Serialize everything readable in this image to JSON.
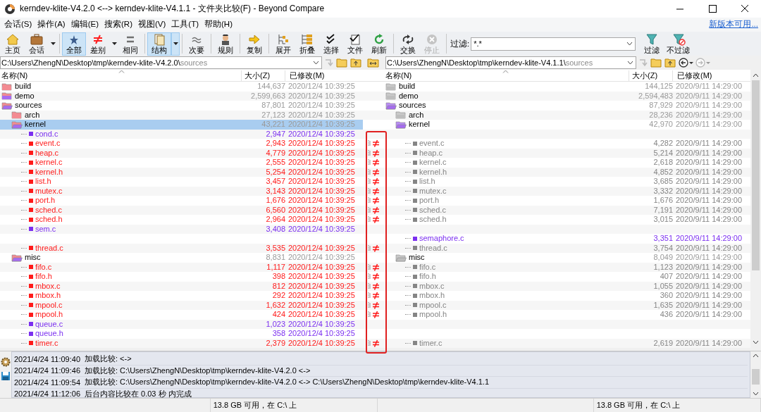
{
  "window": {
    "title": "kerndev-klite-V4.2.0 <--> kerndev-klite-V4.1.1 - 文件夹比较(F) - Beyond Compare"
  },
  "menu": [
    "会话(S)",
    "操作(A)",
    "编辑(E)",
    "搜索(R)",
    "视图(V)",
    "工具(T)",
    "帮助(H)"
  ],
  "update_link": "新版本可用...",
  "toolbar": {
    "groups": [
      [
        {
          "label": "主页",
          "selected": false,
          "disabled": false,
          "dropdown": false
        },
        {
          "label": "会话",
          "selected": false,
          "disabled": false,
          "dropdown": true
        }
      ],
      [
        {
          "label": "全部",
          "selected": true,
          "disabled": false,
          "dropdown": false
        },
        {
          "label": "差别",
          "selected": false,
          "disabled": false,
          "dropdown": true
        },
        {
          "label": "相同",
          "selected": false,
          "disabled": false,
          "dropdown": false
        }
      ],
      [
        {
          "label": "结构",
          "selected": true,
          "disabled": false,
          "dropdown": true
        }
      ],
      [
        {
          "label": "次要",
          "selected": false,
          "disabled": false,
          "dropdown": false
        }
      ],
      [
        {
          "label": "规则",
          "selected": false,
          "disabled": false,
          "dropdown": false
        }
      ],
      [
        {
          "label": "复制",
          "selected": false,
          "disabled": false,
          "dropdown": false
        }
      ],
      [
        {
          "label": "展开",
          "selected": false,
          "disabled": false,
          "dropdown": false
        },
        {
          "label": "折叠",
          "selected": false,
          "disabled": false,
          "dropdown": false
        },
        {
          "label": "选择",
          "selected": false,
          "disabled": false,
          "dropdown": false
        },
        {
          "label": "文件",
          "selected": false,
          "disabled": false,
          "dropdown": false
        },
        {
          "label": "刷新",
          "selected": false,
          "disabled": false,
          "dropdown": false
        }
      ],
      [
        {
          "label": "交换",
          "selected": false,
          "disabled": false,
          "dropdown": false
        },
        {
          "label": "停止",
          "selected": false,
          "disabled": true,
          "dropdown": false
        }
      ]
    ],
    "filter": {
      "label": "过滤:",
      "value": "*.*"
    },
    "filter_buttons": [
      "过滤",
      "不过滤"
    ]
  },
  "left_path": {
    "base": "C:\\Users\\ZhengN\\Desktop\\tmp\\kerndev-klite-V4.2.0\\",
    "subfolder": "sources"
  },
  "right_path": {
    "base": "C:\\Users\\ZhengN\\Desktop\\tmp\\kerndev-klite-V4.1.1\\",
    "subfolder": "sources"
  },
  "left_columns": [
    "名称(N)",
    "大小(Z)",
    "已修改(M)"
  ],
  "right_columns": [
    "名称(N)",
    "大小(Z)",
    "已修改(M)"
  ],
  "rows": [
    {
      "kind": "folder",
      "expanded": false,
      "selected": false,
      "diff": false,
      "left": {
        "name": "build",
        "size": "144,637",
        "modified": "2020/12/4 10:39:25",
        "differs": true,
        "has_orphans": false
      },
      "right": {
        "name": "build",
        "size": "144,125",
        "modified": "2020/9/11 14:29:00",
        "differs": false,
        "has_orphans": false
      }
    },
    {
      "kind": "folder",
      "expanded": false,
      "selected": false,
      "diff": false,
      "left": {
        "name": "demo",
        "size": "2,599,663",
        "modified": "2020/12/4 10:39:25",
        "differs": true,
        "has_orphans": true
      },
      "right": {
        "name": "demo",
        "size": "2,594,483",
        "modified": "2020/9/11 14:29:00",
        "differs": false,
        "has_orphans": false
      }
    },
    {
      "kind": "folder",
      "expanded": true,
      "selected": false,
      "diff": false,
      "left": {
        "name": "sources",
        "size": "87,801",
        "modified": "2020/12/4 10:39:25",
        "differs": true,
        "has_orphans": true
      },
      "right": {
        "name": "sources",
        "size": "87,929",
        "modified": "2020/9/11 14:29:00",
        "differs": false,
        "has_orphans": true
      },
      "children": [
        {
          "kind": "folder",
          "expanded": false,
          "selected": false,
          "diff": false,
          "left": {
            "name": "arch",
            "size": "27,123",
            "modified": "2020/12/4 10:39:25",
            "differs": true,
            "has_orphans": false
          },
          "right": {
            "name": "arch",
            "size": "28,236",
            "modified": "2020/9/11 14:29:00",
            "differs": false,
            "has_orphans": false
          }
        },
        {
          "kind": "folder",
          "expanded": true,
          "selected": true,
          "diff": false,
          "left": {
            "name": "kernel",
            "size": "43,221",
            "modified": "2020/12/4 10:39:25",
            "differs": true,
            "has_orphans": true
          },
          "right": {
            "name": "kernel",
            "size": "42,970",
            "modified": "2020/9/11 14:29:00",
            "differs": false,
            "has_orphans": true
          },
          "children": [
            {
              "kind": "file",
              "selected": false,
              "diff": false,
              "left": {
                "name": "cond.c",
                "size": "2,947",
                "modified": "2020/12/4 10:39:25",
                "newer": false,
                "orphan": true
              }
            },
            {
              "kind": "file",
              "selected": false,
              "diff": true,
              "left": {
                "name": "event.c",
                "size": "2,943",
                "modified": "2020/12/4 10:39:25",
                "newer": true,
                "orphan": false
              },
              "right": {
                "name": "event.c",
                "size": "4,282",
                "modified": "2020/9/11 14:29:00",
                "newer": false,
                "orphan": false
              }
            },
            {
              "kind": "file",
              "selected": false,
              "diff": true,
              "left": {
                "name": "heap.c",
                "size": "4,779",
                "modified": "2020/12/4 10:39:25",
                "newer": true,
                "orphan": false
              },
              "right": {
                "name": "heap.c",
                "size": "5,214",
                "modified": "2020/9/11 14:29:00",
                "newer": false,
                "orphan": false
              }
            },
            {
              "kind": "file",
              "selected": false,
              "diff": true,
              "left": {
                "name": "kernel.c",
                "size": "2,555",
                "modified": "2020/12/4 10:39:25",
                "newer": true,
                "orphan": false
              },
              "right": {
                "name": "kernel.c",
                "size": "2,618",
                "modified": "2020/9/11 14:29:00",
                "newer": false,
                "orphan": false
              }
            },
            {
              "kind": "file",
              "selected": false,
              "diff": true,
              "left": {
                "name": "kernel.h",
                "size": "5,254",
                "modified": "2020/12/4 10:39:25",
                "newer": true,
                "orphan": false
              },
              "right": {
                "name": "kernel.h",
                "size": "4,852",
                "modified": "2020/9/11 14:29:00",
                "newer": false,
                "orphan": false
              }
            },
            {
              "kind": "file",
              "selected": false,
              "diff": true,
              "left": {
                "name": "list.h",
                "size": "3,457",
                "modified": "2020/12/4 10:39:25",
                "newer": true,
                "orphan": false
              },
              "right": {
                "name": "list.h",
                "size": "3,685",
                "modified": "2020/9/11 14:29:00",
                "newer": false,
                "orphan": false
              }
            },
            {
              "kind": "file",
              "selected": false,
              "diff": true,
              "left": {
                "name": "mutex.c",
                "size": "3,143",
                "modified": "2020/12/4 10:39:25",
                "newer": true,
                "orphan": false
              },
              "right": {
                "name": "mutex.c",
                "size": "3,332",
                "modified": "2020/9/11 14:29:00",
                "newer": false,
                "orphan": false
              }
            },
            {
              "kind": "file",
              "selected": false,
              "diff": true,
              "left": {
                "name": "port.h",
                "size": "1,676",
                "modified": "2020/12/4 10:39:25",
                "newer": true,
                "orphan": false
              },
              "right": {
                "name": "port.h",
                "size": "1,676",
                "modified": "2020/9/11 14:29:00",
                "newer": false,
                "orphan": false
              }
            },
            {
              "kind": "file",
              "selected": false,
              "diff": true,
              "left": {
                "name": "sched.c",
                "size": "6,560",
                "modified": "2020/12/4 10:39:25",
                "newer": true,
                "orphan": false
              },
              "right": {
                "name": "sched.c",
                "size": "7,191",
                "modified": "2020/9/11 14:29:00",
                "newer": false,
                "orphan": false
              }
            },
            {
              "kind": "file",
              "selected": false,
              "diff": true,
              "left": {
                "name": "sched.h",
                "size": "2,964",
                "modified": "2020/12/4 10:39:25",
                "newer": true,
                "orphan": false
              },
              "right": {
                "name": "sched.h",
                "size": "3,015",
                "modified": "2020/9/11 14:29:00",
                "newer": false,
                "orphan": false
              }
            },
            {
              "kind": "file",
              "selected": false,
              "diff": false,
              "left": {
                "name": "sem.c",
                "size": "3,408",
                "modified": "2020/12/4 10:39:25",
                "newer": false,
                "orphan": true
              }
            },
            {
              "kind": "file",
              "selected": false,
              "diff": false,
              "right": {
                "name": "semaphore.c",
                "size": "3,351",
                "modified": "2020/9/11 14:29:00",
                "newer": false,
                "orphan": true
              }
            },
            {
              "kind": "file",
              "selected": false,
              "diff": true,
              "left": {
                "name": "thread.c",
                "size": "3,535",
                "modified": "2020/12/4 10:39:25",
                "newer": true,
                "orphan": false
              },
              "right": {
                "name": "thread.c",
                "size": "3,754",
                "modified": "2020/9/11 14:29:00",
                "newer": false,
                "orphan": false
              }
            }
          ]
        },
        {
          "kind": "folder",
          "expanded": true,
          "selected": false,
          "diff": false,
          "left": {
            "name": "misc",
            "size": "8,831",
            "modified": "2020/12/4 10:39:25",
            "differs": true,
            "has_orphans": true
          },
          "right": {
            "name": "misc",
            "size": "8,049",
            "modified": "2020/9/11 14:29:00",
            "differs": false,
            "has_orphans": false
          },
          "children": [
            {
              "kind": "file",
              "selected": false,
              "diff": true,
              "left": {
                "name": "fifo.c",
                "size": "1,117",
                "modified": "2020/12/4 10:39:25",
                "newer": true,
                "orphan": false
              },
              "right": {
                "name": "fifo.c",
                "size": "1,123",
                "modified": "2020/9/11 14:29:00",
                "newer": false,
                "orphan": false
              }
            },
            {
              "kind": "file",
              "selected": false,
              "diff": true,
              "left": {
                "name": "fifo.h",
                "size": "398",
                "modified": "2020/12/4 10:39:25",
                "newer": true,
                "orphan": false
              },
              "right": {
                "name": "fifo.h",
                "size": "407",
                "modified": "2020/9/11 14:29:00",
                "newer": false,
                "orphan": false
              }
            },
            {
              "kind": "file",
              "selected": false,
              "diff": true,
              "left": {
                "name": "mbox.c",
                "size": "812",
                "modified": "2020/12/4 10:39:25",
                "newer": true,
                "orphan": false
              },
              "right": {
                "name": "mbox.c",
                "size": "1,055",
                "modified": "2020/9/11 14:29:00",
                "newer": false,
                "orphan": false
              }
            },
            {
              "kind": "file",
              "selected": false,
              "diff": true,
              "left": {
                "name": "mbox.h",
                "size": "292",
                "modified": "2020/12/4 10:39:25",
                "newer": true,
                "orphan": false
              },
              "right": {
                "name": "mbox.h",
                "size": "360",
                "modified": "2020/9/11 14:29:00",
                "newer": false,
                "orphan": false
              }
            },
            {
              "kind": "file",
              "selected": false,
              "diff": true,
              "left": {
                "name": "mpool.c",
                "size": "1,632",
                "modified": "2020/12/4 10:39:25",
                "newer": true,
                "orphan": false
              },
              "right": {
                "name": "mpool.c",
                "size": "1,635",
                "modified": "2020/9/11 14:29:00",
                "newer": false,
                "orphan": false
              }
            },
            {
              "kind": "file",
              "selected": false,
              "diff": true,
              "left": {
                "name": "mpool.h",
                "size": "424",
                "modified": "2020/12/4 10:39:25",
                "newer": true,
                "orphan": false
              },
              "right": {
                "name": "mpool.h",
                "size": "436",
                "modified": "2020/9/11 14:29:00",
                "newer": false,
                "orphan": false
              }
            },
            {
              "kind": "file",
              "selected": false,
              "diff": false,
              "left": {
                "name": "queue.c",
                "size": "1,023",
                "modified": "2020/12/4 10:39:25",
                "newer": false,
                "orphan": true
              }
            },
            {
              "kind": "file",
              "selected": false,
              "diff": false,
              "left": {
                "name": "queue.h",
                "size": "358",
                "modified": "2020/12/4 10:39:25",
                "newer": false,
                "orphan": true
              }
            },
            {
              "kind": "file",
              "selected": false,
              "diff": true,
              "left": {
                "name": "timer.c",
                "size": "2,379",
                "modified": "2020/12/4 10:39:25",
                "newer": true,
                "orphan": false
              },
              "right": {
                "name": "timer.c",
                "size": "2,619",
                "modified": "2020/9/11 14:29:00",
                "newer": false,
                "orphan": false
              }
            }
          ]
        }
      ]
    }
  ],
  "log": [
    {
      "time": "2021/4/24 11:09:40",
      "message": "加载比较: <->"
    },
    {
      "time": "2021/4/24 11:09:46",
      "message": "加载比较: C:\\Users\\ZhengN\\Desktop\\tmp\\kerndev-klite-V4.2.0 <->"
    },
    {
      "time": "2021/4/24 11:09:54",
      "message": "加载比较: C:\\Users\\ZhengN\\Desktop\\tmp\\kerndev-klite-V4.2.0 <-> C:\\Users\\ZhengN\\Desktop\\tmp\\kerndev-klite-V4.1.1"
    },
    {
      "time": "2021/4/24 11:12:06",
      "message": "后台内容比较在 0.03 秒 内完成"
    }
  ],
  "status_bar": [
    "13.8 GB 可用，在 C:\\ 上",
    "13.8 GB 可用，在 C:\\ 上"
  ]
}
